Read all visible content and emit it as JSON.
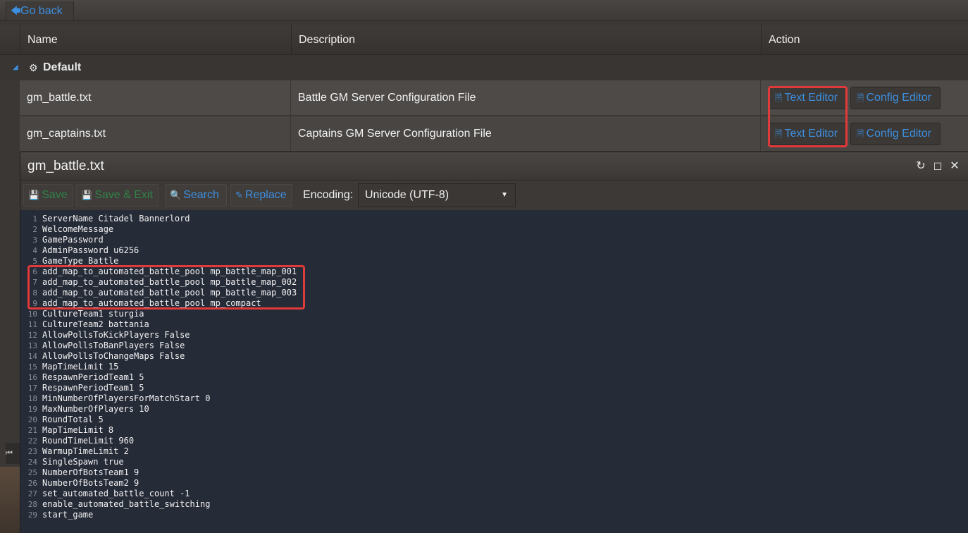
{
  "nav": {
    "go_back": "Go back"
  },
  "grid": {
    "columns": {
      "name": "Name",
      "description": "Description",
      "action": "Action"
    },
    "group": "Default",
    "rows": [
      {
        "name": "gm_battle.txt",
        "description": "Battle GM Server Configuration File",
        "text_editor": "Text Editor",
        "config_editor": "Config Editor"
      },
      {
        "name": "gm_captains.txt",
        "description": "Captains GM Server Configuration File",
        "text_editor": "Text Editor",
        "config_editor": "Config Editor"
      }
    ]
  },
  "modal": {
    "title": "gm_battle.txt",
    "toolbar": {
      "save": "Save",
      "save_exit": "Save & Exit",
      "search": "Search",
      "replace": "Replace",
      "encoding_label": "Encoding:",
      "encoding_value": "Unicode (UTF-8)"
    },
    "lines": [
      "ServerName Citadel Bannerlord",
      "WelcomeMessage",
      "GamePassword",
      "AdminPassword u6256",
      "GameType Battle",
      "add_map_to_automated_battle_pool mp_battle_map_001",
      "add_map_to_automated_battle_pool mp_battle_map_002",
      "add_map_to_automated_battle_pool mp_battle_map_003",
      "add_map_to_automated_battle_pool mp_compact",
      "CultureTeam1 sturgia",
      "CultureTeam2 battania",
      "AllowPollsToKickPlayers False",
      "AllowPollsToBanPlayers False",
      "AllowPollsToChangeMaps False",
      "MapTimeLimit 15",
      "RespawnPeriodTeam1 5",
      "RespawnPeriodTeam1 5",
      "MinNumberOfPlayersForMatchStart 0",
      "MaxNumberOfPlayers 10",
      "RoundTotal 5",
      "MapTimeLimit 8",
      "RoundTimeLimit 960",
      "WarmupTimeLimit 2",
      "SingleSpawn true",
      "NumberOfBotsTeam1 9",
      "NumberOfBotsTeam2 9",
      "set_automated_battle_count -1",
      "enable_automated_battle_switching",
      "start_game"
    ]
  },
  "colors": {
    "accent": "#3d8fe0",
    "highlight": "#e03a3a"
  }
}
